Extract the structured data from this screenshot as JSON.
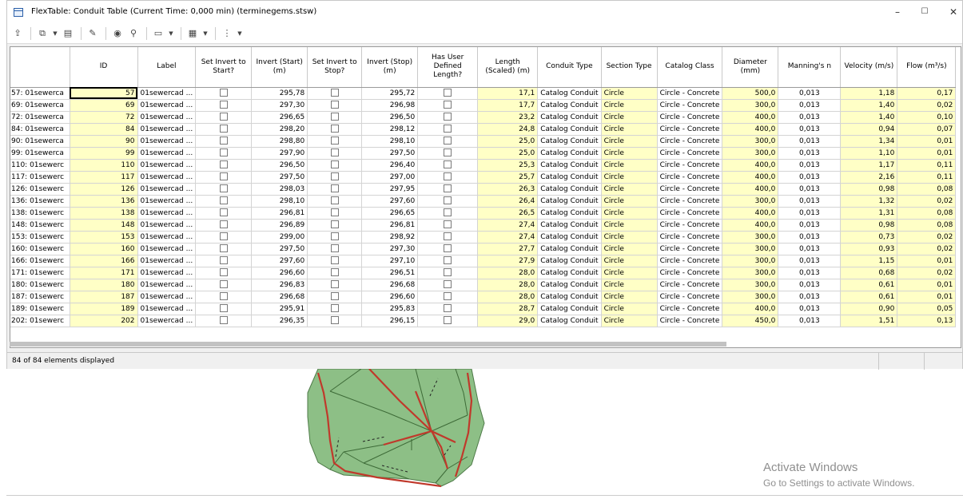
{
  "window": {
    "title": "FlexTable: Conduit Table (Current Time: 0,000 min) (terminegems.stsw)",
    "minimize": "–",
    "maximize": "☐",
    "close": "✕"
  },
  "toolbar": {
    "icons": [
      "export-icon",
      "copy-icon",
      "dropdown",
      "paste-icon",
      "edit-icon",
      "zoom-icon",
      "find-icon",
      "report-icon",
      "dropdown",
      "options-icon",
      "dropdown",
      "filter-icon",
      "dropdown"
    ]
  },
  "table": {
    "columns": [
      {
        "key": "rowheader",
        "label": ""
      },
      {
        "key": "id",
        "label": "ID"
      },
      {
        "key": "label",
        "label": "Label"
      },
      {
        "key": "sis",
        "label": "Set Invert to Start?"
      },
      {
        "key": "inv_start",
        "label": "Invert (Start) (m)"
      },
      {
        "key": "sit",
        "label": "Set Invert to Stop?"
      },
      {
        "key": "inv_stop",
        "label": "Invert (Stop) (m)"
      },
      {
        "key": "udl",
        "label": "Has User Defined Length?"
      },
      {
        "key": "length",
        "label": "Length (Scaled) (m)"
      },
      {
        "key": "ctype",
        "label": "Conduit Type"
      },
      {
        "key": "stype",
        "label": "Section Type"
      },
      {
        "key": "cclass",
        "label": "Catalog Class"
      },
      {
        "key": "diam",
        "label": "Diameter (mm)"
      },
      {
        "key": "mann",
        "label": "Manning's n"
      },
      {
        "key": "vel",
        "label": "Velocity (m/s)"
      },
      {
        "key": "flow",
        "label": "Flow (m³/s)"
      }
    ],
    "rows": [
      {
        "rh": "57: 01sewerca",
        "id": "57",
        "label": "01sewercad ...",
        "inv_start": "295,78",
        "inv_stop": "295,72",
        "length": "17,1",
        "ctype": "Catalog Conduit",
        "stype": "Circle",
        "cclass": "Circle - Concrete",
        "diam": "500,0",
        "mann": "0,013",
        "vel": "1,18",
        "flow": "0,17"
      },
      {
        "rh": "69: 01sewerca",
        "id": "69",
        "label": "01sewercad ...",
        "inv_start": "297,30",
        "inv_stop": "296,98",
        "length": "17,7",
        "ctype": "Catalog Conduit",
        "stype": "Circle",
        "cclass": "Circle - Concrete",
        "diam": "300,0",
        "mann": "0,013",
        "vel": "1,40",
        "flow": "0,02"
      },
      {
        "rh": "72: 01sewerca",
        "id": "72",
        "label": "01sewercad ...",
        "inv_start": "296,65",
        "inv_stop": "296,50",
        "length": "23,2",
        "ctype": "Catalog Conduit",
        "stype": "Circle",
        "cclass": "Circle - Concrete",
        "diam": "400,0",
        "mann": "0,013",
        "vel": "1,40",
        "flow": "0,10"
      },
      {
        "rh": "84: 01sewerca",
        "id": "84",
        "label": "01sewercad ...",
        "inv_start": "298,20",
        "inv_stop": "298,12",
        "length": "24,8",
        "ctype": "Catalog Conduit",
        "stype": "Circle",
        "cclass": "Circle - Concrete",
        "diam": "400,0",
        "mann": "0,013",
        "vel": "0,94",
        "flow": "0,07"
      },
      {
        "rh": "90: 01sewerca",
        "id": "90",
        "label": "01sewercad ...",
        "inv_start": "298,80",
        "inv_stop": "298,10",
        "length": "25,0",
        "ctype": "Catalog Conduit",
        "stype": "Circle",
        "cclass": "Circle - Concrete",
        "diam": "300,0",
        "mann": "0,013",
        "vel": "1,34",
        "flow": "0,01"
      },
      {
        "rh": "99: 01sewerca",
        "id": "99",
        "label": "01sewercad ...",
        "inv_start": "297,90",
        "inv_stop": "297,50",
        "length": "25,0",
        "ctype": "Catalog Conduit",
        "stype": "Circle",
        "cclass": "Circle - Concrete",
        "diam": "300,0",
        "mann": "0,013",
        "vel": "1,10",
        "flow": "0,01"
      },
      {
        "rh": "110: 01sewerc",
        "id": "110",
        "label": "01sewercad ...",
        "inv_start": "296,50",
        "inv_stop": "296,40",
        "length": "25,3",
        "ctype": "Catalog Conduit",
        "stype": "Circle",
        "cclass": "Circle - Concrete",
        "diam": "400,0",
        "mann": "0,013",
        "vel": "1,17",
        "flow": "0,11"
      },
      {
        "rh": "117: 01sewerc",
        "id": "117",
        "label": "01sewercad ...",
        "inv_start": "297,50",
        "inv_stop": "297,00",
        "length": "25,7",
        "ctype": "Catalog Conduit",
        "stype": "Circle",
        "cclass": "Circle - Concrete",
        "diam": "400,0",
        "mann": "0,013",
        "vel": "2,16",
        "flow": "0,11"
      },
      {
        "rh": "126: 01sewerc",
        "id": "126",
        "label": "01sewercad ...",
        "inv_start": "298,03",
        "inv_stop": "297,95",
        "length": "26,3",
        "ctype": "Catalog Conduit",
        "stype": "Circle",
        "cclass": "Circle - Concrete",
        "diam": "400,0",
        "mann": "0,013",
        "vel": "0,98",
        "flow": "0,08"
      },
      {
        "rh": "136: 01sewerc",
        "id": "136",
        "label": "01sewercad ...",
        "inv_start": "298,10",
        "inv_stop": "297,60",
        "length": "26,4",
        "ctype": "Catalog Conduit",
        "stype": "Circle",
        "cclass": "Circle - Concrete",
        "diam": "300,0",
        "mann": "0,013",
        "vel": "1,32",
        "flow": "0,02"
      },
      {
        "rh": "138: 01sewerc",
        "id": "138",
        "label": "01sewercad ...",
        "inv_start": "296,81",
        "inv_stop": "296,65",
        "length": "26,5",
        "ctype": "Catalog Conduit",
        "stype": "Circle",
        "cclass": "Circle - Concrete",
        "diam": "400,0",
        "mann": "0,013",
        "vel": "1,31",
        "flow": "0,08"
      },
      {
        "rh": "148: 01sewerc",
        "id": "148",
        "label": "01sewercad ...",
        "inv_start": "296,89",
        "inv_stop": "296,81",
        "length": "27,4",
        "ctype": "Catalog Conduit",
        "stype": "Circle",
        "cclass": "Circle - Concrete",
        "diam": "400,0",
        "mann": "0,013",
        "vel": "0,98",
        "flow": "0,08"
      },
      {
        "rh": "153: 01sewerc",
        "id": "153",
        "label": "01sewercad ...",
        "inv_start": "299,00",
        "inv_stop": "298,92",
        "length": "27,4",
        "ctype": "Catalog Conduit",
        "stype": "Circle",
        "cclass": "Circle - Concrete",
        "diam": "300,0",
        "mann": "0,013",
        "vel": "0,73",
        "flow": "0,02"
      },
      {
        "rh": "160: 01sewerc",
        "id": "160",
        "label": "01sewercad ...",
        "inv_start": "297,50",
        "inv_stop": "297,30",
        "length": "27,7",
        "ctype": "Catalog Conduit",
        "stype": "Circle",
        "cclass": "Circle - Concrete",
        "diam": "300,0",
        "mann": "0,013",
        "vel": "0,93",
        "flow": "0,02"
      },
      {
        "rh": "166: 01sewerc",
        "id": "166",
        "label": "01sewercad ...",
        "inv_start": "297,60",
        "inv_stop": "297,10",
        "length": "27,9",
        "ctype": "Catalog Conduit",
        "stype": "Circle",
        "cclass": "Circle - Concrete",
        "diam": "300,0",
        "mann": "0,013",
        "vel": "1,15",
        "flow": "0,01"
      },
      {
        "rh": "171: 01sewerc",
        "id": "171",
        "label": "01sewercad ...",
        "inv_start": "296,60",
        "inv_stop": "296,51",
        "length": "28,0",
        "ctype": "Catalog Conduit",
        "stype": "Circle",
        "cclass": "Circle - Concrete",
        "diam": "300,0",
        "mann": "0,013",
        "vel": "0,68",
        "flow": "0,02"
      },
      {
        "rh": "180: 01sewerc",
        "id": "180",
        "label": "01sewercad ...",
        "inv_start": "296,83",
        "inv_stop": "296,68",
        "length": "28,0",
        "ctype": "Catalog Conduit",
        "stype": "Circle",
        "cclass": "Circle - Concrete",
        "diam": "300,0",
        "mann": "0,013",
        "vel": "0,61",
        "flow": "0,01"
      },
      {
        "rh": "187: 01sewerc",
        "id": "187",
        "label": "01sewercad ...",
        "inv_start": "296,68",
        "inv_stop": "296,60",
        "length": "28,0",
        "ctype": "Catalog Conduit",
        "stype": "Circle",
        "cclass": "Circle - Concrete",
        "diam": "300,0",
        "mann": "0,013",
        "vel": "0,61",
        "flow": "0,01"
      },
      {
        "rh": "189: 01sewerc",
        "id": "189",
        "label": "01sewercad ...",
        "inv_start": "295,91",
        "inv_stop": "295,83",
        "length": "28,7",
        "ctype": "Catalog Conduit",
        "stype": "Circle",
        "cclass": "Circle - Concrete",
        "diam": "400,0",
        "mann": "0,013",
        "vel": "0,90",
        "flow": "0,05"
      },
      {
        "rh": "202: 01sewerc",
        "id": "202",
        "label": "01sewercad ...",
        "inv_start": "296,35",
        "inv_stop": "296,15",
        "length": "29,0",
        "ctype": "Catalog Conduit",
        "stype": "Circle",
        "cclass": "Circle - Concrete",
        "diam": "450,0",
        "mann": "0,013",
        "vel": "1,51",
        "flow": "0,13"
      }
    ]
  },
  "status": {
    "text": "84 of 84 elements displayed"
  },
  "watermark": {
    "line1": "Activate Windows",
    "line2": "Go to Settings to activate Windows."
  },
  "colors": {
    "yellow_cell": "#ffffc6",
    "map_fill": "#8dbf86",
    "map_pipe": "#c0392b"
  }
}
